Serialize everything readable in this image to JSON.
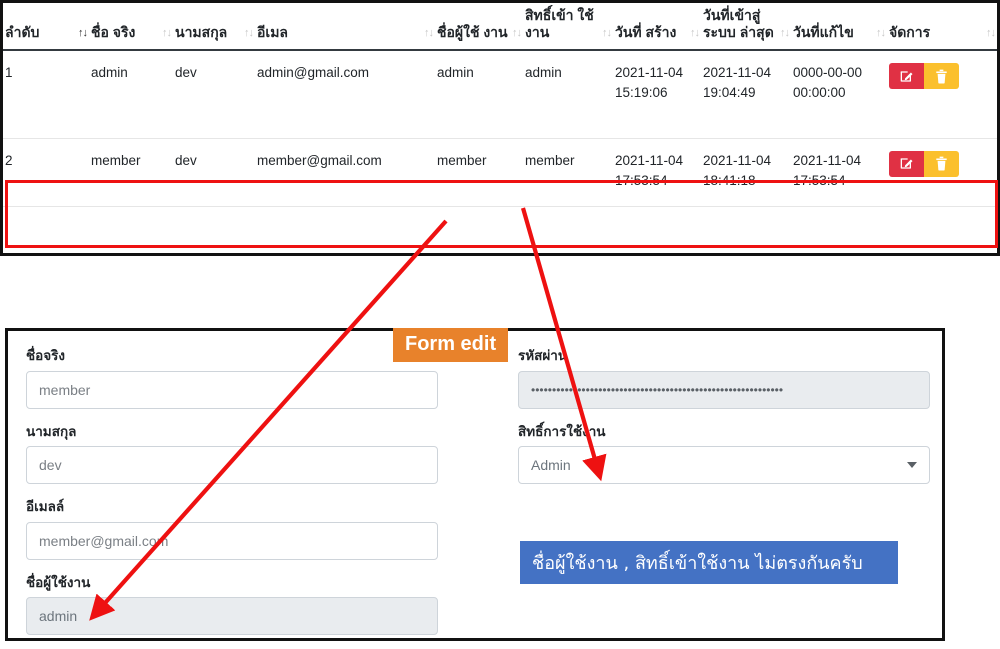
{
  "table": {
    "columns": [
      {
        "label": "ลำดับ",
        "sort_icon": "sort-updown-icon",
        "sort_active": true
      },
      {
        "label": "ชื่อ จริง",
        "sort_icon": "sort-updown-icon",
        "sort_active": false
      },
      {
        "label": "นามสกุล",
        "sort_icon": "sort-updown-icon",
        "sort_active": false
      },
      {
        "label": "อีเมล",
        "sort_icon": "sort-updown-icon",
        "sort_active": false
      },
      {
        "label": "ชื่อผู้ใช้ งาน",
        "sort_icon": "sort-updown-icon",
        "sort_active": false
      },
      {
        "label": "สิทธิ์เข้า ใช้งาน",
        "sort_icon": "sort-updown-icon",
        "sort_active": false
      },
      {
        "label": "วันที่ สร้าง",
        "sort_icon": "sort-updown-icon",
        "sort_active": false
      },
      {
        "label": "วันที่เข้าสู่ ระบบ ล่าสุด",
        "sort_icon": "sort-updown-icon",
        "sort_active": false
      },
      {
        "label": "วันที่แก้ไข",
        "sort_icon": "sort-updown-icon",
        "sort_active": false
      },
      {
        "label": "จัดการ",
        "sort_icon": "sort-updown-icon",
        "sort_active": false
      }
    ],
    "rows": [
      {
        "order": "1",
        "firstname": "admin",
        "lastname": "dev",
        "email": "admin@gmail.com",
        "username": "admin",
        "role": "admin",
        "created": "2021-11-04 15:19:06",
        "last_login": "2021-11-04 19:04:49",
        "updated": "0000-00-00 00:00:00",
        "highlighted": false
      },
      {
        "order": "2",
        "firstname": "member",
        "lastname": "dev",
        "email": "member@gmail.com",
        "username": "member",
        "role": "member",
        "created": "2021-11-04 17:53:54",
        "last_login": "2021-11-04 18:41:18",
        "updated": "2021-11-04 17:53:54",
        "highlighted": true
      }
    ],
    "actions": {
      "edit_icon": "pencil-square-icon",
      "delete_icon": "trash-icon",
      "edit_color": "#e03144",
      "delete_color": "#fbc02d"
    },
    "highlight_color": "#ee1111"
  },
  "annotation": {
    "form_edit_tag": "Form edit",
    "form_edit_tag_color": "#e8822b",
    "arrow_color": "#ee1111"
  },
  "form": {
    "left": [
      {
        "label": "ชื่อจริง",
        "name": "firstname-field",
        "value": "member",
        "type": "text",
        "readonly": false
      },
      {
        "label": "นามสกุล",
        "name": "lastname-field",
        "value": "dev",
        "type": "text",
        "readonly": false
      },
      {
        "label": "อีเมลล์",
        "name": "email-field",
        "value": "member@gmail.com",
        "type": "text",
        "readonly": false
      },
      {
        "label": "ชื่อผู้ใช้งาน",
        "name": "username-field",
        "value": "admin",
        "type": "text",
        "readonly": true
      }
    ],
    "right": [
      {
        "label": "รหัสผ่าน",
        "name": "password-field",
        "value": "••••••••••••••••••••••••••••••••••••••••••••••••••••••••••••",
        "type": "password",
        "readonly": true
      },
      {
        "label": "สิทธิ์การใช้งาน",
        "name": "role-select",
        "value": "Admin",
        "type": "select",
        "readonly": false
      }
    ],
    "alert": {
      "text": "ชื่อผู้ใช้งาน , สิทธิ์เข้าใช้งาน ไม่ตรงกันครับ",
      "bg_color": "#4472c4",
      "text_color": "#ffffff"
    }
  }
}
